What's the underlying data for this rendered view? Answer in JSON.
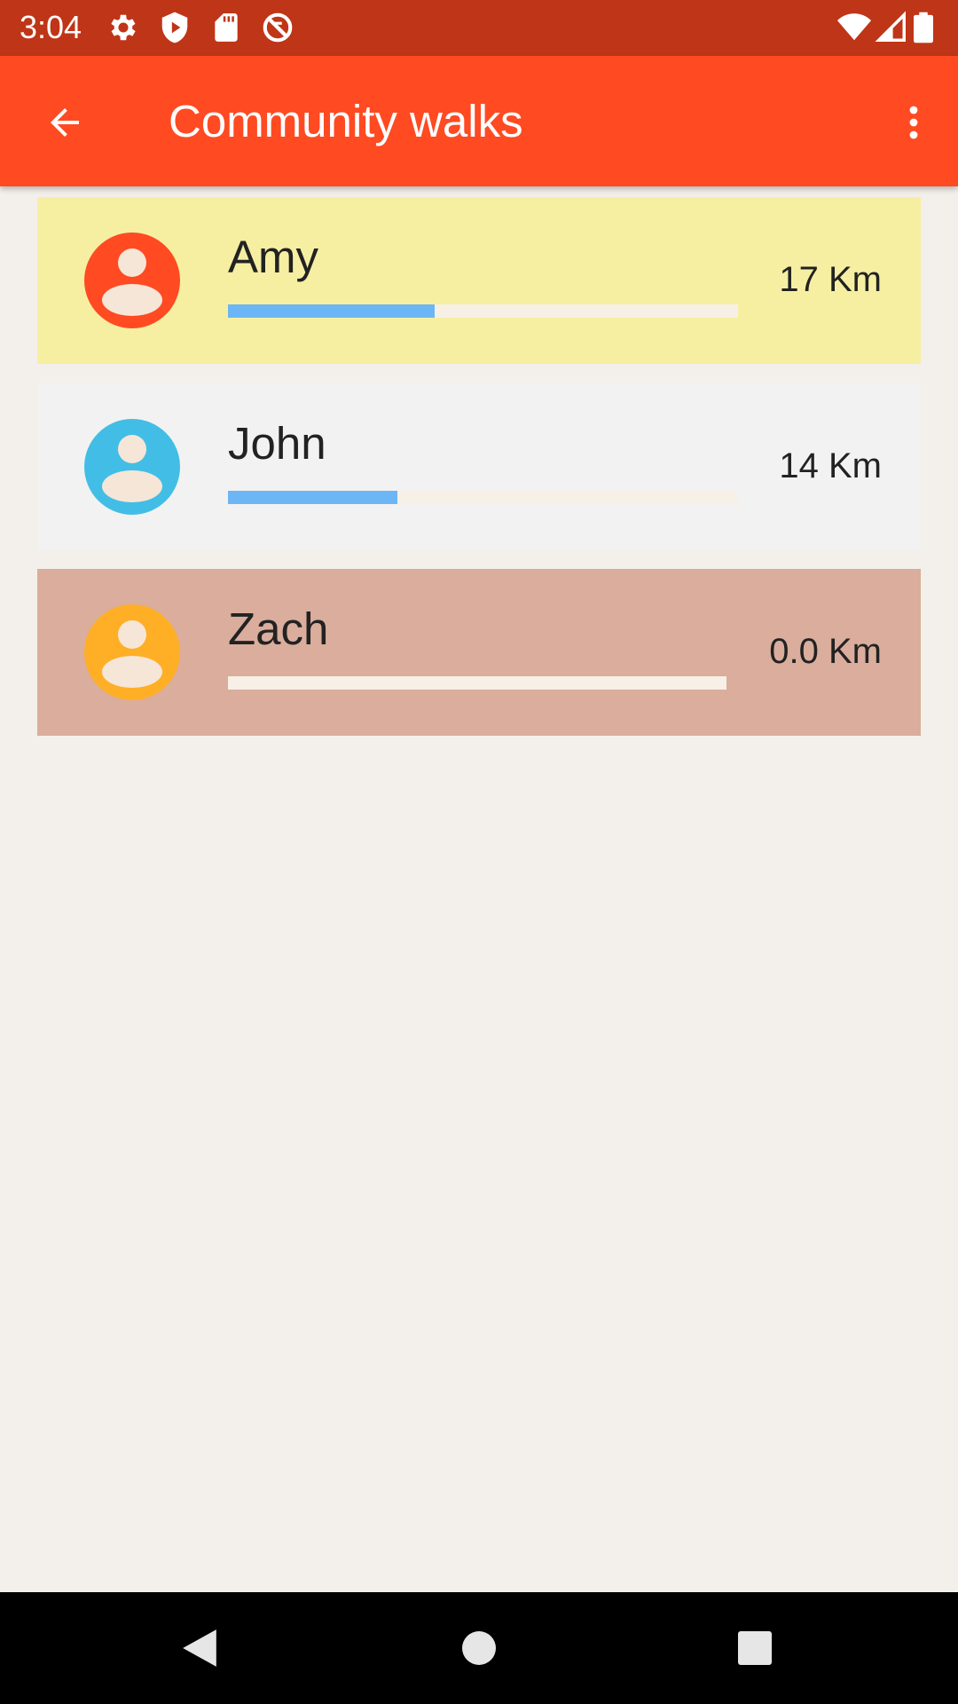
{
  "status_bar": {
    "time": "3:04",
    "left_icons": [
      "gear-icon",
      "shield-play-icon",
      "sd-card-icon",
      "no-sync-icon"
    ],
    "right_icons": [
      "wifi-icon",
      "cell-signal-icon",
      "battery-icon"
    ]
  },
  "app_bar": {
    "title": "Community walks",
    "background": "#FF4A22"
  },
  "walkers": [
    {
      "name": "Amy",
      "distance": "17 Km",
      "progress": 0.405,
      "card_color": "#F6EFA2",
      "avatar_color": "#FF4A22"
    },
    {
      "name": "John",
      "distance": "14 Km",
      "progress": 0.333,
      "card_color": "#F3F2F2",
      "avatar_color": "#42BEE6"
    },
    {
      "name": "Zach",
      "distance": "0.0 Km",
      "progress": 0.0,
      "card_color": "#DAAD9C",
      "avatar_color": "#FFAF26"
    }
  ],
  "nav_bar": {
    "buttons": [
      "back-triangle-icon",
      "home-circle-icon",
      "recents-square-icon"
    ]
  }
}
